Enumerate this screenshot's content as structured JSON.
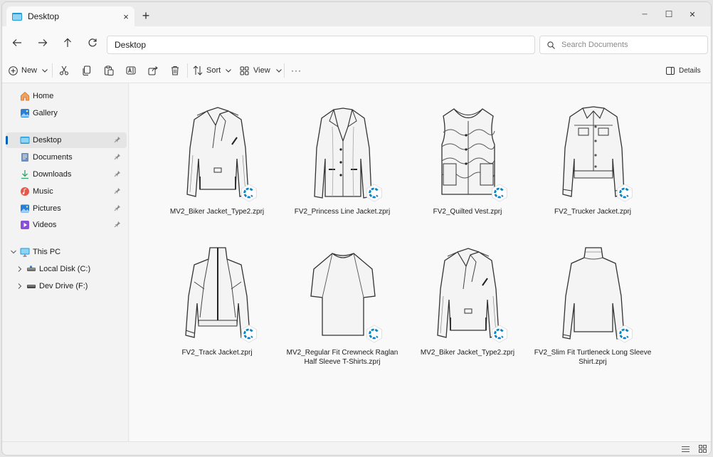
{
  "window": {
    "tab_title": "Desktop",
    "tab_close": "×",
    "new_tab": "+",
    "minimize": "─",
    "maximize": "☐",
    "close": "✕"
  },
  "address": {
    "path": "Desktop",
    "search_placeholder": "Search Documents"
  },
  "toolbar": {
    "new_label": "New",
    "sort_label": "Sort",
    "view_label": "View",
    "more_label": "···",
    "details_label": "Details"
  },
  "sidebar": {
    "items": [
      {
        "label": "Home",
        "icon": "home-icon"
      },
      {
        "label": "Gallery",
        "icon": "gallery-icon"
      },
      {
        "label": "Desktop",
        "icon": "desktop-icon",
        "pinned": true,
        "selected": true
      },
      {
        "label": "Documents",
        "icon": "documents-icon",
        "pinned": true
      },
      {
        "label": "Downloads",
        "icon": "downloads-icon",
        "pinned": true
      },
      {
        "label": "Music",
        "icon": "music-icon",
        "pinned": true
      },
      {
        "label": "Pictures",
        "icon": "pictures-icon",
        "pinned": true
      },
      {
        "label": "Videos",
        "icon": "videos-icon",
        "pinned": true
      },
      {
        "label": "This PC",
        "icon": "this-pc-icon",
        "expanded": true
      },
      {
        "label": "Local Disk (C:)",
        "icon": "drive-icon"
      },
      {
        "label": "Dev Drive (F:)",
        "icon": "drive-icon"
      }
    ]
  },
  "files": [
    {
      "name": "MV2_Biker Jacket_Type2.zprj",
      "garment": "biker-jacket"
    },
    {
      "name": "FV2_Princess Line Jacket.zprj",
      "garment": "princess-line-jacket"
    },
    {
      "name": "FV2_Quilted Vest.zprj",
      "garment": "quilted-vest"
    },
    {
      "name": "FV2_Trucker Jacket.zprj",
      "garment": "trucker-jacket"
    },
    {
      "name": "FV2_Track Jacket.zprj",
      "garment": "track-jacket"
    },
    {
      "name": "MV2_Regular Fit Crewneck Raglan Half Sleeve T-Shirts.zprj",
      "garment": "raglan-tshirt"
    },
    {
      "name": "MV2_Biker Jacket_Type2.zprj",
      "garment": "biker-jacket"
    },
    {
      "name": "FV2_Slim Fit Turtleneck Long Sleeve Shirt.zprj",
      "garment": "turtleneck-shirt"
    }
  ],
  "colors": {
    "accent": "#005fb8",
    "badge": "#0a84c8"
  }
}
